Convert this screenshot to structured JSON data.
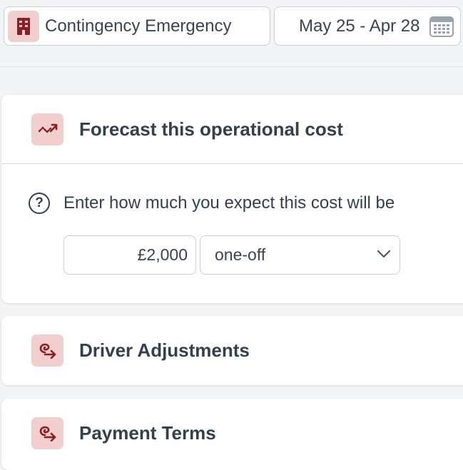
{
  "header": {
    "entity": {
      "label": "Contingency Emergency",
      "icon": "building-icon"
    },
    "date_range": {
      "label": "May 25 - Apr 28",
      "icon": "calendar-icon"
    }
  },
  "forecast_card": {
    "title": "Forecast this operational cost",
    "icon": "trend-arrow-icon",
    "question": "Enter how much you expect this cost will be",
    "help_icon": "question-icon",
    "amount_value": "£2,000",
    "frequency_value": "one-off"
  },
  "driver_card": {
    "title": "Driver Adjustments",
    "icon": "route-arrow-icon"
  },
  "payment_card": {
    "title": "Payment Terms",
    "icon": "route-arrow-icon"
  },
  "colors": {
    "accent": "#8c1d22",
    "accent_tile": "#f2cfcf",
    "text": "#34404d",
    "border": "#c9cfd6",
    "background": "#f2f4f6"
  }
}
